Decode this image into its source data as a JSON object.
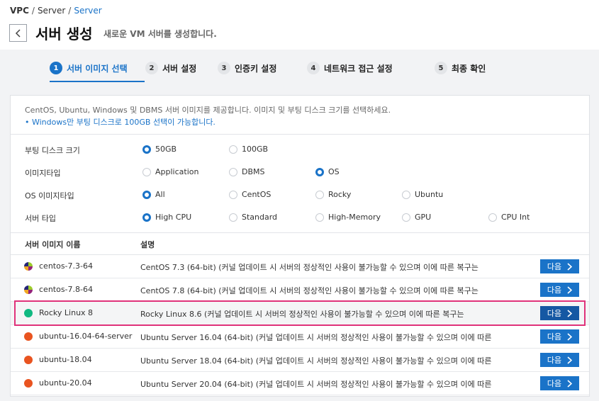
{
  "breadcrumb": {
    "root": "VPC",
    "mid": "Server",
    "current": "Server",
    "sep": "/"
  },
  "page": {
    "title": "서버 생성",
    "subtitle": "새로운 VM 서버를 생성합니다."
  },
  "steps": [
    {
      "num": "1",
      "label": "서버 이미지 선택",
      "active": true
    },
    {
      "num": "2",
      "label": "서버 설정"
    },
    {
      "num": "3",
      "label": "인증키 설정"
    },
    {
      "num": "4",
      "label": "네트워크 접근 설정"
    },
    {
      "num": "5",
      "label": "최종 확인"
    }
  ],
  "notice": {
    "line1": "CentOS, Ubuntu, Windows 및 DBMS 서버 이미지를 제공합니다. 이미지 및 부팅 디스크 크기를 선택하세요.",
    "line2": "• Windows만 부팅 디스크로 100GB 선택이 가능합니다."
  },
  "options": {
    "boot_disk": {
      "label": "부팅 디스크 크기",
      "choices": [
        "50GB",
        "100GB"
      ],
      "selected": "50GB"
    },
    "image_type": {
      "label": "이미지타입",
      "choices": [
        "Application",
        "DBMS",
        "OS"
      ],
      "selected": "OS"
    },
    "os_image_type": {
      "label": "OS 이미지타입",
      "choices": [
        "All",
        "CentOS",
        "Rocky",
        "Ubuntu"
      ],
      "selected": "All"
    },
    "server_type": {
      "label": "서버 타입",
      "choices": [
        "High CPU",
        "Standard",
        "High-Memory",
        "GPU",
        "CPU Int"
      ],
      "selected": "High CPU"
    }
  },
  "table": {
    "col_name": "서버 이미지 이름",
    "col_desc": "설명",
    "next_label": "다음",
    "rows": [
      {
        "name": "centos-7.3-64",
        "desc": "CentOS 7.3 (64-bit) (커널 업데이트 시 서버의 정상적인 사용이 불가능할 수 있으며 이에 따른 복구는",
        "icon": "centos-icon"
      },
      {
        "name": "centos-7.8-64",
        "desc": "CentOS 7.8 (64-bit) (커널 업데이트 시 서버의 정상적인 사용이 불가능할 수 있으며 이에 따른 복구는",
        "icon": "centos-icon"
      },
      {
        "name": "Rocky Linux 8",
        "desc": "Rocky Linux 8.6 (커널 업데이트 시 서버의 정상적인 사용이 불가능할 수 있으며 이에 따른 복구는",
        "icon": "rocky-icon",
        "selected": true
      },
      {
        "name": "ubuntu-16.04-64-server",
        "desc": "Ubuntu Server 16.04 (64-bit) (커널 업데이트 시 서버의 정상적인 사용이 불가능할 수 있으며 이에 따른",
        "icon": "ubuntu-icon"
      },
      {
        "name": "ubuntu-18.04",
        "desc": "Ubuntu Server 18.04 (64-bit) (커널 업데이트 시 서버의 정상적인 사용이 불가능할 수 있으며 이에 따른",
        "icon": "ubuntu-icon"
      },
      {
        "name": "ubuntu-20.04",
        "desc": "Ubuntu Server 20.04 (64-bit) (커널 업데이트 시 서버의 정상적인 사용이 불가능할 수 있으며 이에 따른",
        "icon": "ubuntu-icon"
      }
    ]
  },
  "colors": {
    "accent": "#1a73c8",
    "highlight": "#e0327a"
  }
}
